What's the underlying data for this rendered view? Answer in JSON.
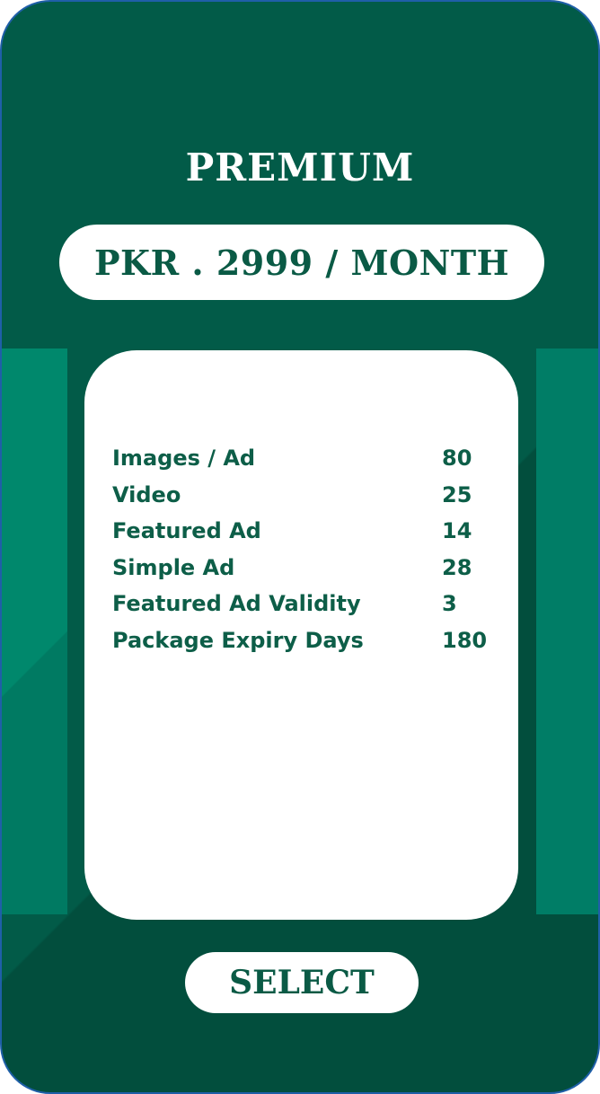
{
  "plan": {
    "name": "PREMIUM",
    "price_label": "PKR . 2999 / MONTH"
  },
  "features": [
    {
      "label": "Images / Ad",
      "value": "80"
    },
    {
      "label": "Video",
      "value": "25"
    },
    {
      "label": "Featured Ad",
      "value": "14"
    },
    {
      "label": "Simple Ad",
      "value": "28"
    },
    {
      "label": "Featured Ad Validity",
      "value": "3"
    },
    {
      "label": "Package Expiry Days",
      "value": "180"
    }
  ],
  "actions": {
    "select_label": "SELECT"
  },
  "colors": {
    "card_background": "#025b48",
    "accent_band": "#00886c",
    "text_dark_green": "#0a5a45",
    "border": "#1f5fa8"
  }
}
